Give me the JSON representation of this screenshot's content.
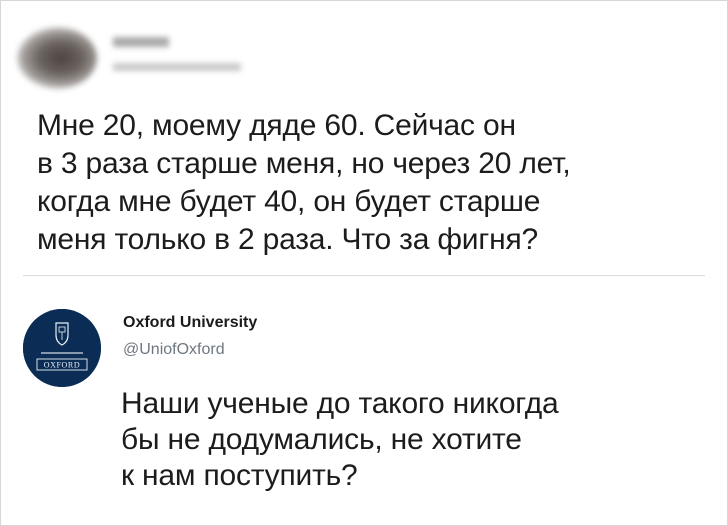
{
  "first_tweet": {
    "text": "Мне 20, моему дяде 60. Сейчас он\nв 3 раза старше меня, но через 20 лет,\nкогда мне будет 40, он будет старше\nменя только в 2 раза. Что за фигня?"
  },
  "reply_tweet": {
    "display_name": "Oxford University",
    "handle": "@UniofOxford",
    "avatar_text": "OXFORD",
    "text": "Наши ученые до такого никогда\nбы не додумались, не хотите\nк нам поступить?"
  },
  "colors": {
    "text": "#1c1c1c",
    "handle": "#6e7780",
    "oxford_blue": "#0b2d55",
    "divider": "#dcdcdc"
  }
}
